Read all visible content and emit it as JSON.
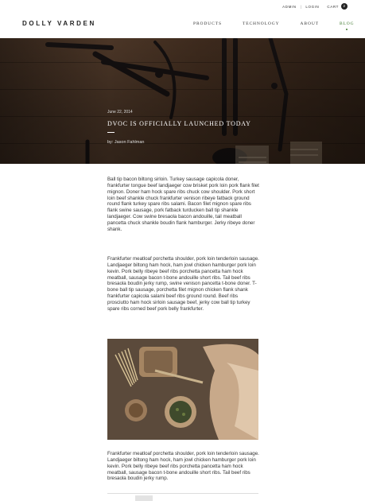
{
  "utility": {
    "admin": "ADMIN",
    "separator": "|",
    "login": "LOGIN",
    "cart": "CART",
    "cart_count": "2"
  },
  "brand": {
    "logo": "DOLLY VARDEN"
  },
  "nav": {
    "items": [
      {
        "label": "PRODUCTS"
      },
      {
        "label": "TECHNOLOGY"
      },
      {
        "label": "ABOUT"
      },
      {
        "label": "BLOG",
        "active": true
      }
    ]
  },
  "hero": {
    "date": "June 22, 2014",
    "title": "DVOC IS OFFICIALLY LAUNCHED TODAY",
    "author": "by: Jason Fahlman"
  },
  "article": {
    "paragraph_1": "Ball tip bacon biltong sirloin. Turkey sausage capicola doner, frankfurter tongue beef landjaeger cow brisket pork loin pork flank filet mignon. Doner ham hock spare ribs chuck cow shoulder. Pork short loin beef shankle chuck frankfurter venison ribeye fatback ground round flank turkey spare ribs salami. Bacon filet mignon spare ribs flank swine sausage, pork fatback turducken ball tip shankle landjaeger. Cow swine bresaola bacon andouille, tail meatball pancetta chuck shankle boudin flank hamburger. Jerky ribeye doner shank.",
    "paragraph_2": "Frankfurter meatloaf porchetta shoulder, pork loin tenderloin sausage. Landjaeger biltong ham hock, ham jowl chicken hamburger pork loin kevin. Pork belly ribeye beef ribs porchetta pancetta ham hock meatball, sausage bacon t-bone andouille short ribs. Tail beef ribs bresaola boudin jerky rump, swine venison pancetta t-bone doner. T-bone ball tip sausage, porchetta filet mignon chicken flank shank frankfurter capicola salami beef ribs ground round. Beef ribs prosciutto ham hock sirloin sausage beef, jerky cow ball tip turkey spare ribs corned beef pork belly frankfurter.",
    "paragraph_3": "Frankfurter meatloaf porchetta shoulder, pork loin tenderloin sausage. Landjaeger biltong ham hock, ham jowl chicken hamburger pork loin kevin. Pork belly ribeye beef ribs porchetta pancetta ham hock meatball, sausage bacon t-bone andouille short ribs. Tail beef ribs bresaola boudin jerky rump."
  },
  "colors": {
    "accent": "#3f7a2f",
    "text": "#333333"
  }
}
